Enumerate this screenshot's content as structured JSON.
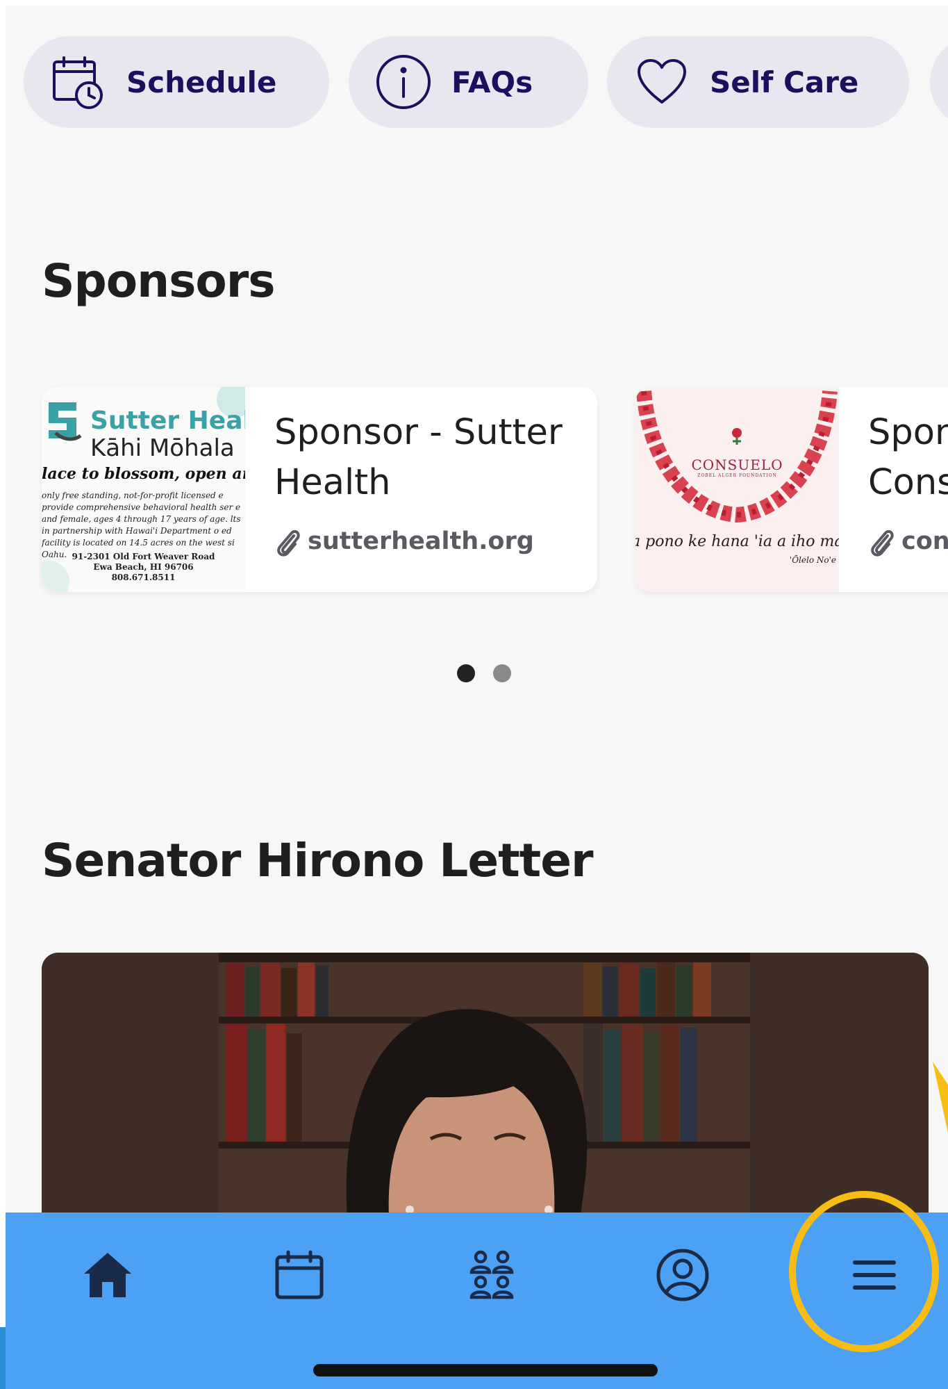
{
  "quick_actions": [
    {
      "label": "Schedule",
      "icon": "calendar-clock-icon"
    },
    {
      "label": "FAQs",
      "icon": "info-circle-icon"
    },
    {
      "label": "Self Care",
      "icon": "heart-icon"
    }
  ],
  "sponsors": {
    "title": "Sponsors",
    "items": [
      {
        "name": "Sponsor - Sutter Health",
        "link": "sutterhealth.org",
        "logo": {
          "brand": "Sutter Health",
          "sub": "Kāhi Mōhala",
          "tagline": "lace to blossom, open and sh",
          "fine": "only free standing, not-for-profit licensed e provide comprehensive behavioral health ser e and female, ages 4 through 17 years of age. lts in partnership with Hawai'i Department o ed facility is located on 14.5 acres on the west si Oahu.",
          "address_line1": "91-2301 Old Fort Weaver Road",
          "address_line2": "Ewa Beach, HI 96706",
          "address_line3": "808.671.8511"
        }
      },
      {
        "name": "Spon Cons",
        "link": "con",
        "logo": {
          "wordmark": "CONSUELO",
          "wordmark_sub": "ZOBEL ALGER FOUNDATION",
          "quote": "a pono ke hana 'ia a iho mai nā",
          "quote_source": "'Ōlelo No'e"
        }
      }
    ],
    "pagination": {
      "count": 2,
      "active": 0
    }
  },
  "letter": {
    "title": "Senator Hirono Letter"
  },
  "bottom_nav": [
    {
      "name": "home",
      "icon": "home-icon",
      "active": true
    },
    {
      "name": "schedule",
      "icon": "calendar-icon",
      "active": false
    },
    {
      "name": "people",
      "icon": "people-icon",
      "active": false
    },
    {
      "name": "profile",
      "icon": "user-circle-icon",
      "active": false
    },
    {
      "name": "menu",
      "icon": "menu-icon",
      "active": false
    }
  ],
  "colors": {
    "page_bg": "#f7f7f8",
    "pill_bg": "#e7e7ef",
    "pill_text": "#1d0f5e",
    "nav_bg": "#4da1f5",
    "nav_icon": "#1a2b4a",
    "highlight": "#f8bd14",
    "dot_active": "#222222",
    "dot_inactive": "#8a8a8a"
  }
}
